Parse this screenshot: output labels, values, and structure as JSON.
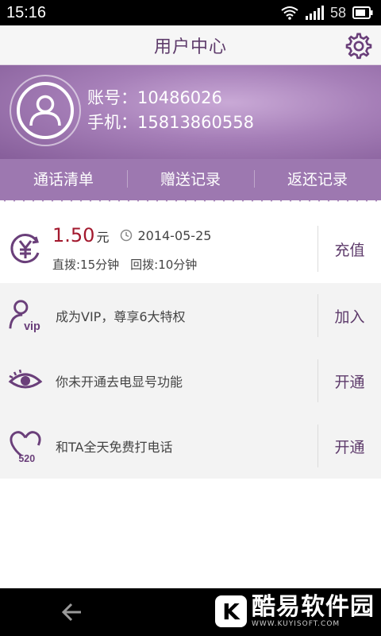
{
  "status_bar": {
    "time": "15:16",
    "battery": "58"
  },
  "title_bar": {
    "title": "用户中心"
  },
  "profile": {
    "account_label": "账号：",
    "account_value": "10486026",
    "phone_label": "手机：",
    "phone_value": "15813860558"
  },
  "tabs": [
    {
      "label": "通话清单"
    },
    {
      "label": "赠送记录"
    },
    {
      "label": "返还记录"
    }
  ],
  "balance": {
    "amount": "1.50",
    "unit": "元",
    "date": "2014-05-25",
    "direct_dial": "直拨:15分钟",
    "callback": "回拨:10分钟",
    "action": "充值"
  },
  "features": [
    {
      "text": "成为VIP，尊享6大特权",
      "action": "加入",
      "icon": "vip-user-icon"
    },
    {
      "text": "你未开通去电显号功能",
      "action": "开通",
      "icon": "eye-icon"
    },
    {
      "text": "和TA全天免费打电话",
      "action": "开通",
      "icon": "heart-520-icon"
    }
  ],
  "icon_text": {
    "vip": "vip",
    "heart": "520"
  },
  "watermark": {
    "text": "酷易软件园",
    "site": "WWW.KUYISOFT.COM",
    "logo": "K"
  },
  "colors": {
    "accent": "#5e3b6b",
    "header": "#a67fb8",
    "amount": "#a3192e"
  }
}
